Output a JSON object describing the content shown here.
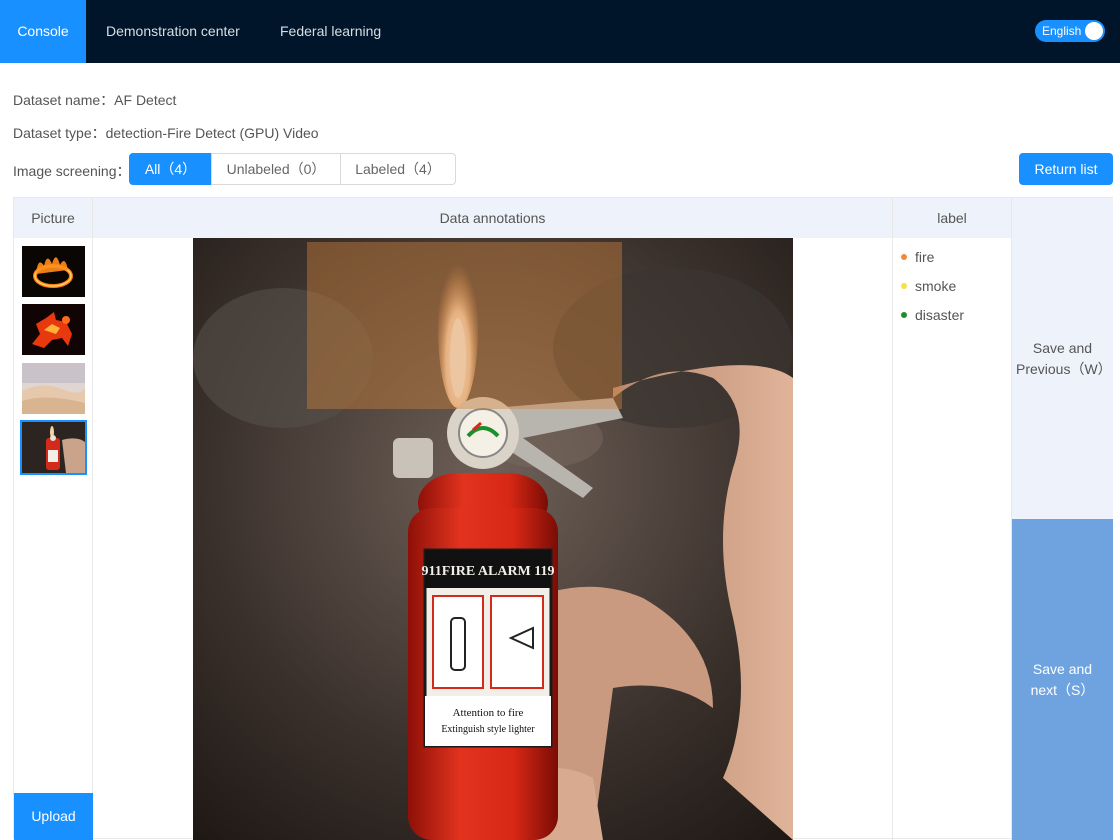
{
  "nav": {
    "items": [
      {
        "label": "Console",
        "active": true
      },
      {
        "label": "Demonstration center",
        "active": false
      },
      {
        "label": "Federal learning",
        "active": false
      }
    ],
    "language": {
      "label": "English",
      "on": true
    }
  },
  "dataset": {
    "name_label": "Dataset name：",
    "name_value": "AF Detect",
    "type_label": "Dataset type：",
    "type_value": "detection-Fire Detect (GPU) Video"
  },
  "screening": {
    "label": "Image screening：",
    "options": [
      {
        "label": "All（4）",
        "selected": true
      },
      {
        "label": "Unlabeled（0）",
        "selected": false
      },
      {
        "label": "Labeled（4）",
        "selected": false
      }
    ]
  },
  "return_button": "Return list",
  "table": {
    "headers": {
      "picture": "Picture",
      "annotations": "Data annotations",
      "label": "label"
    },
    "thumbnails": [
      {
        "icon": "fire-ring-image",
        "selected": false
      },
      {
        "icon": "fire-horse-image",
        "selected": false
      },
      {
        "icon": "desert-dunes-image",
        "selected": false
      },
      {
        "icon": "lighter-extinguisher-image",
        "selected": true
      }
    ],
    "upload_button": "Upload",
    "main_image": {
      "icon": "lighter-extinguisher-image",
      "printed_text": [
        "911FIRE ALARM 119",
        "Attention to fire",
        "Extinguish style lighter"
      ]
    },
    "labels": [
      {
        "name": "fire",
        "color": "#f08a3a"
      },
      {
        "name": "smoke",
        "color": "#f5e04a"
      },
      {
        "name": "disaster",
        "color": "#1a8f2e"
      }
    ],
    "actions": {
      "prev_line1": "Save and",
      "prev_line2": "Previous（W）",
      "next_line1": "Save and",
      "next_line2": "next（S）"
    }
  },
  "colors": {
    "accent": "#1890ff",
    "nav_bg": "#00152a",
    "header_bg": "#eef3fb",
    "next_bg": "#6fa3e0",
    "bbox": "rgba(210,130,60,0.42)"
  }
}
